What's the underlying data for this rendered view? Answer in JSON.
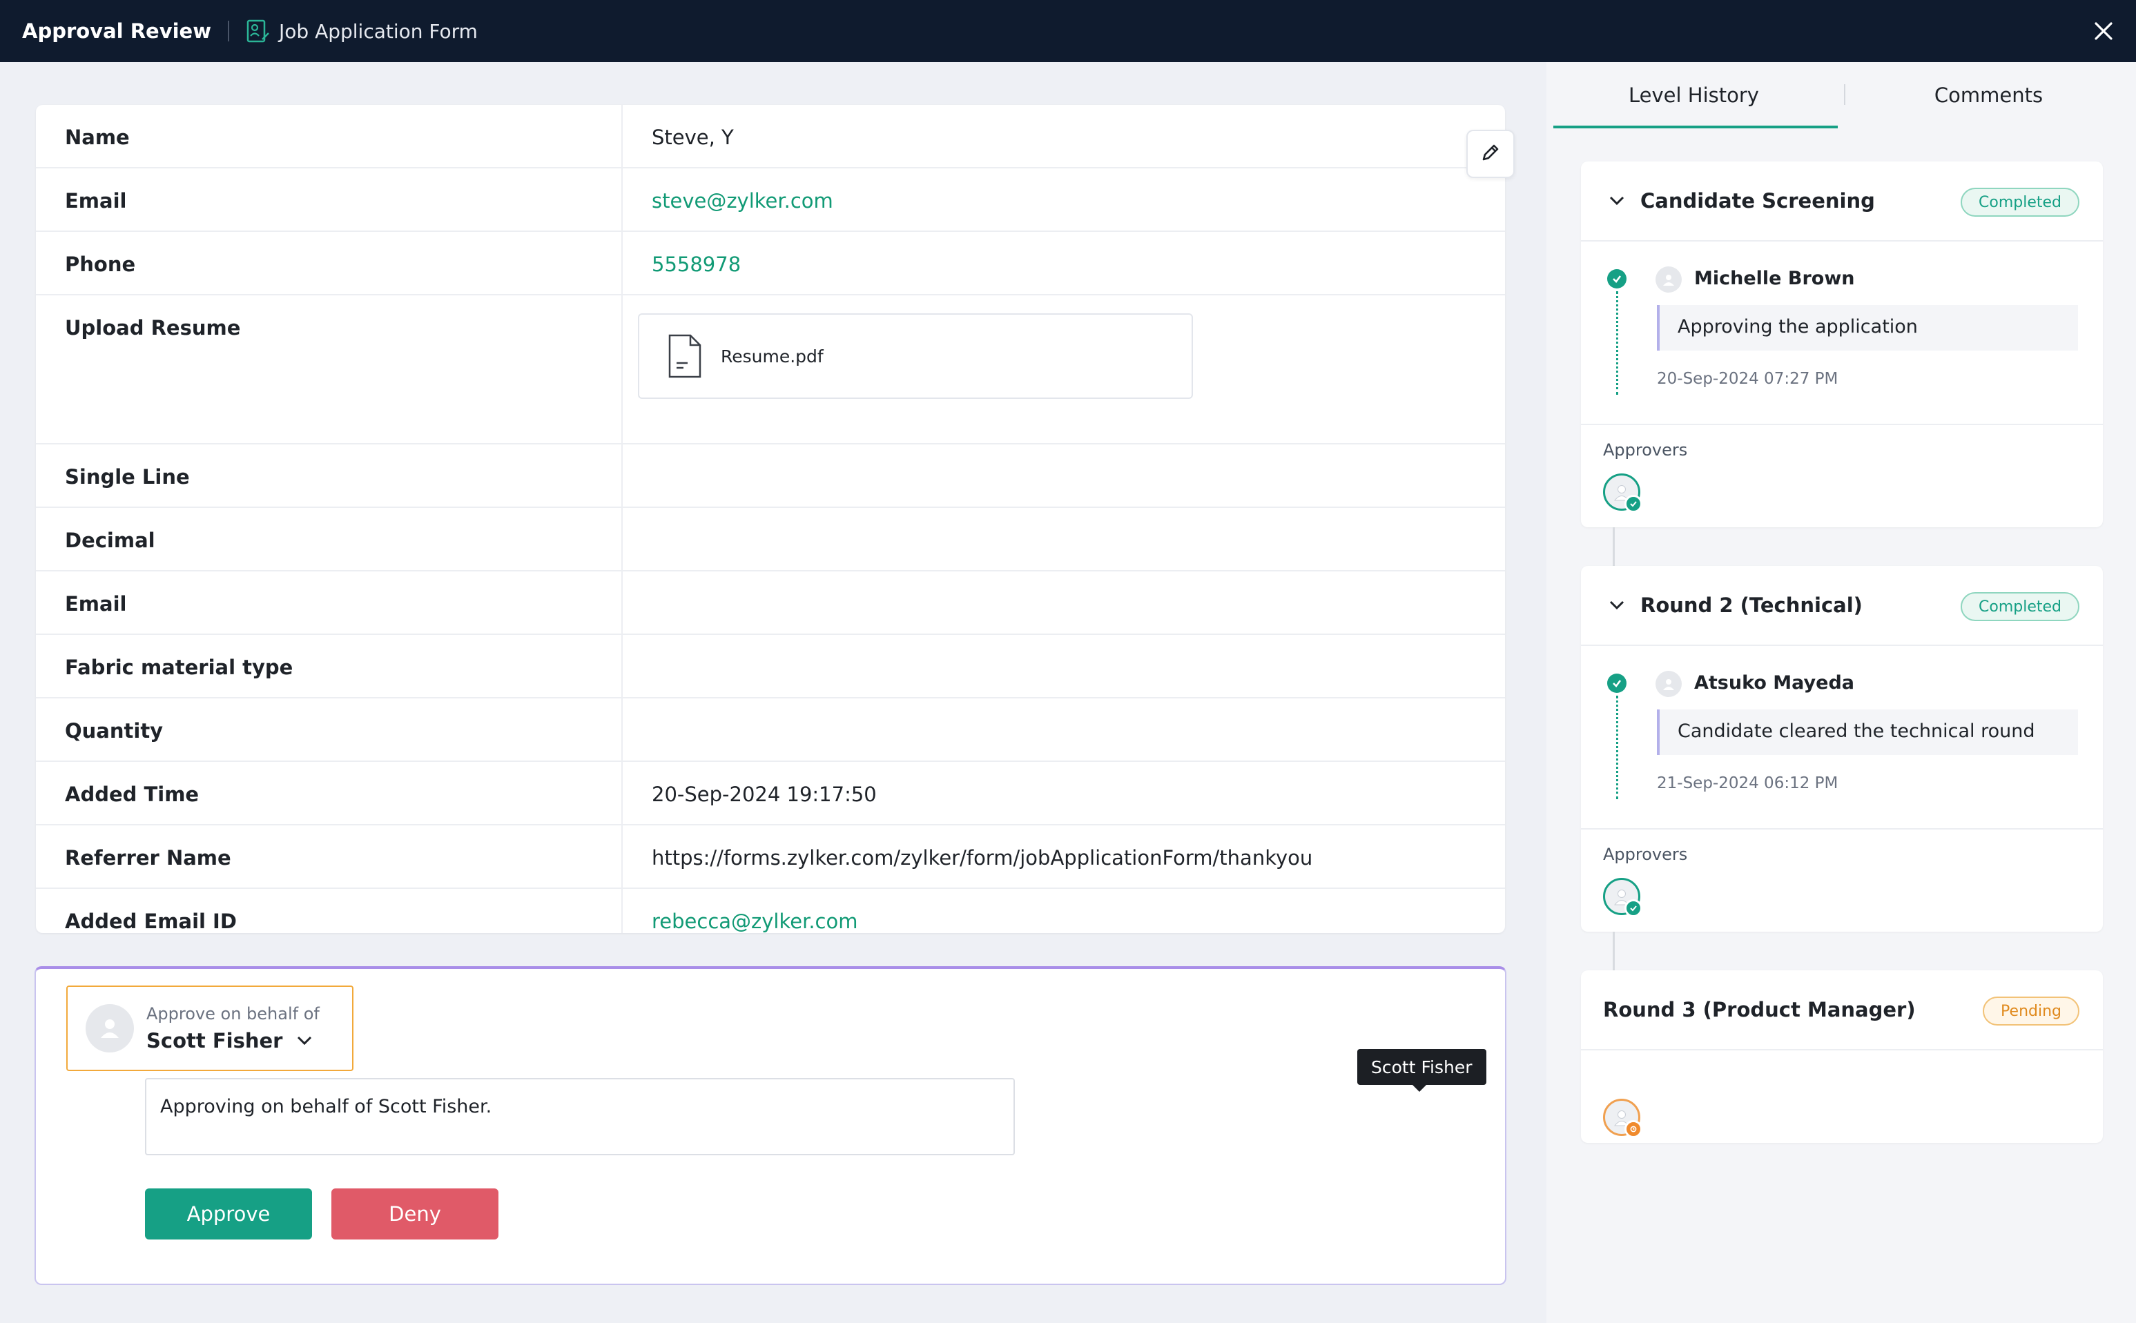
{
  "header": {
    "title": "Approval Review",
    "form_name": "Job Application Form"
  },
  "details": [
    {
      "label": "Name",
      "value": "Steve, Y",
      "link": false
    },
    {
      "label": "Email",
      "value": "steve@zylker.com",
      "link": true
    },
    {
      "label": "Phone",
      "value": "5558978",
      "link": true
    },
    {
      "label": "Upload Resume",
      "file": "Resume.pdf"
    },
    {
      "label": "Single Line",
      "value": ""
    },
    {
      "label": "Decimal",
      "value": ""
    },
    {
      "label": "Email",
      "value": ""
    },
    {
      "label": "Fabric material type",
      "value": ""
    },
    {
      "label": "Quantity",
      "value": ""
    },
    {
      "label": "Added Time",
      "value": "20-Sep-2024 19:17:50",
      "link": false
    },
    {
      "label": "Referrer Name",
      "value": "https://forms.zylker.com/zylker/form/jobApplicationForm/thankyou",
      "link": false
    },
    {
      "label": "Added Email ID",
      "value": "rebecca@zylker.com",
      "link": true
    }
  ],
  "approval": {
    "behalf_caption": "Approve on behalf of",
    "behalf_name": "Scott Fisher",
    "note": "Approving on behalf of Scott Fisher.",
    "approve_label": "Approve",
    "deny_label": "Deny"
  },
  "tabs": [
    "Level History",
    "Comments"
  ],
  "levels": [
    {
      "name": "Candidate Screening",
      "status": "Completed",
      "user": "Michelle Brown",
      "message": "Approving the application",
      "timestamp": "20-Sep-2024 07:27 PM",
      "approvers_label": "Approvers"
    },
    {
      "name": "Round 2 (Technical)",
      "status": "Completed",
      "user": "Atsuko Mayeda",
      "message": "Candidate cleared the technical round",
      "timestamp": "21-Sep-2024 06:12 PM",
      "approvers_label": "Approvers"
    },
    {
      "name": "Round 3 (Product Manager)",
      "status": "Pending"
    }
  ],
  "tooltip": "Scott Fisher",
  "colors": {
    "accent": "#16a085",
    "deny": "#e05a68",
    "pending": "#e08a1e",
    "header_bg": "#0f1b2e"
  },
  "icons": {
    "close": "close-icon",
    "edit": "pencil-icon",
    "form": "form-icon",
    "file": "file-icon",
    "chevron": "chevron-down-icon",
    "user": "user-icon",
    "check": "check-icon"
  }
}
